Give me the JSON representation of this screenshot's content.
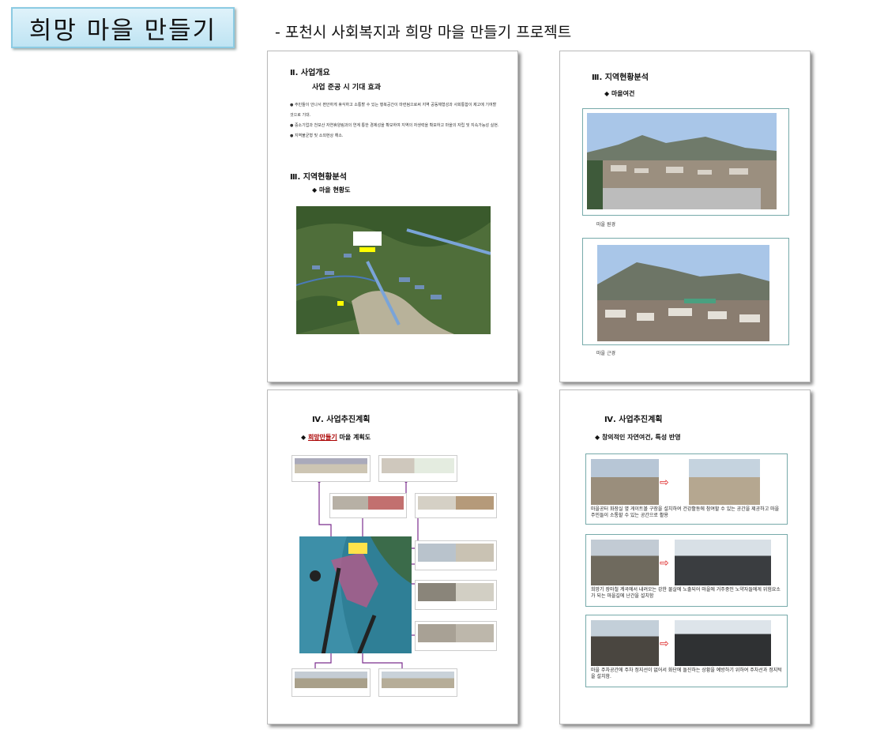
{
  "header": {
    "title": "희망 마을 만들기",
    "subtitle": "-  포천시 사회복지과 희망 마을 만들기 프로젝트"
  },
  "page1": {
    "section1": "Ⅱ. 사업개요",
    "section1_sub": "사업 준공 시 기대 효과",
    "bullets": [
      "주민들이 안나서 편안하게 휴식하고 소통할 수 있는 행복공간이 마련됨으로써 지역 공동체형성과 사회통합이 제고에 기여할 것으로 기대.",
      "중소기업과 천보산 자연휴양림과의 연계 통한 경제성을 확보하여 지역의 자생력을 확보하고 마을의 자립 및 지속가능성 실현.",
      "지역불균형 및 소외현상 해소."
    ],
    "section2": "Ⅲ. 지역현황분석",
    "section2_sub": "◆ 마을 현황도"
  },
  "page2": {
    "section": "Ⅲ. 지역현황분석",
    "sub": "◆ 마을여건",
    "caption1": "마을 원경",
    "caption2": "마을 근경"
  },
  "page3": {
    "section": "Ⅳ. 사업추진계획",
    "sub_prefix": "◆ ",
    "sub_u": "희망만들기",
    "sub_rest": " 마을 계획도"
  },
  "page4": {
    "section": "Ⅳ. 사업추진계획",
    "sub": "◆ 창의적인 자연여건, 특성 반영",
    "row1": "마을공터 화장실 옆 게이트볼 구장을 설치하여 건강활동에 참여할 수 있는 공간을 제공하고 마을 주민들이 소통할 수 있는 공간으로 활용",
    "row2": "희망기 장마철 계곡에서 내려오는 강한 물살에 노출되어 마을에 거주중인 노약자들에게 위험요소가 되는 마을길에 난간을 설치함",
    "row3": "마을 주차공간에 주차 정지선이 없어서 화단에 돌진하는 상황을 예방하기 위하여 주차선과 정지턱을 설치함."
  },
  "colors": {
    "title_bg": "#cfeaf6",
    "accent_purple": "#7b2d8e",
    "arrow_red": "#dd2222"
  }
}
